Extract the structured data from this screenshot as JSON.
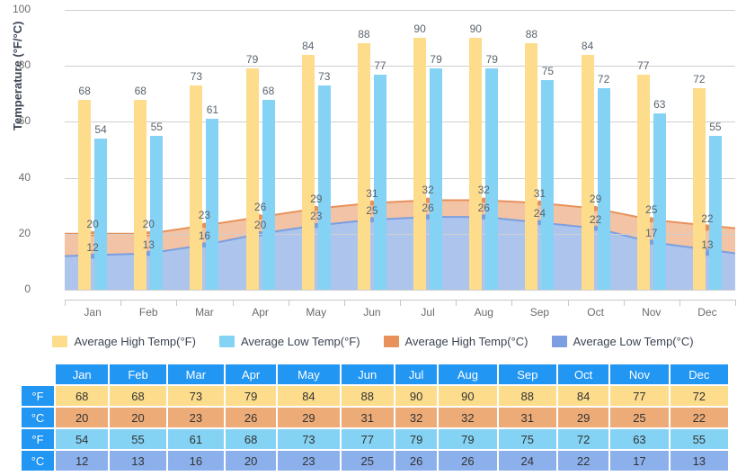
{
  "chart_data": {
    "type": "bar",
    "title": "",
    "xlabel": "",
    "ylabel": "Temperature (°F/°C)",
    "ylim": [
      0,
      100
    ],
    "yticks": [
      0,
      20,
      40,
      60,
      80,
      100
    ],
    "grid": true,
    "legend_position": "bottom",
    "categories": [
      "Jan",
      "Feb",
      "Mar",
      "Apr",
      "May",
      "Jun",
      "Jul",
      "Aug",
      "Sep",
      "Oct",
      "Nov",
      "Dec"
    ],
    "series": [
      {
        "name": "Average High Temp(°F)",
        "type": "bar",
        "color": "#fddc8c",
        "values": [
          68,
          68,
          73,
          79,
          84,
          88,
          90,
          90,
          88,
          84,
          77,
          72
        ]
      },
      {
        "name": "Average Low Temp(°F)",
        "type": "bar",
        "color": "#84d3f5",
        "values": [
          54,
          55,
          61,
          68,
          73,
          77,
          79,
          79,
          75,
          72,
          63,
          55
        ]
      },
      {
        "name": "Average High Temp(°C)",
        "type": "area",
        "color": "#e8915a",
        "values": [
          20,
          20,
          23,
          26,
          29,
          31,
          32,
          32,
          31,
          29,
          25,
          22
        ]
      },
      {
        "name": "Average Low Temp(°C)",
        "type": "area",
        "color": "#7b9fe0",
        "values": [
          12,
          13,
          16,
          20,
          23,
          25,
          26,
          26,
          24,
          22,
          17,
          13
        ]
      }
    ]
  },
  "legend": {
    "items": [
      {
        "label": "Average High Temp(°F)",
        "color": "#fddc8c"
      },
      {
        "label": "Average Low Temp(°F)",
        "color": "#84d3f5"
      },
      {
        "label": "Average High Temp(°C)",
        "color": "#e8915a"
      },
      {
        "label": "Average Low Temp(°C)",
        "color": "#7b9fe0"
      }
    ]
  },
  "table": {
    "corner": "",
    "columns": [
      "Jan",
      "Feb",
      "Mar",
      "Apr",
      "May",
      "Jun",
      "Jul",
      "Aug",
      "Sep",
      "Oct",
      "Nov",
      "Dec"
    ],
    "rows": [
      {
        "head": "°F",
        "style": "v-fh",
        "values": [
          "68",
          "68",
          "73",
          "79",
          "84",
          "88",
          "90",
          "90",
          "88",
          "84",
          "77",
          "72"
        ]
      },
      {
        "head": "°C",
        "style": "v-ch",
        "values": [
          "20",
          "20",
          "23",
          "26",
          "29",
          "31",
          "32",
          "32",
          "31",
          "29",
          "25",
          "22"
        ]
      },
      {
        "head": "°F",
        "style": "v-fl",
        "values": [
          "54",
          "55",
          "61",
          "68",
          "73",
          "77",
          "79",
          "79",
          "75",
          "72",
          "63",
          "55"
        ]
      },
      {
        "head": "°C",
        "style": "v-cl",
        "values": [
          "12",
          "13",
          "16",
          "20",
          "23",
          "25",
          "26",
          "26",
          "24",
          "22",
          "17",
          "13"
        ]
      }
    ]
  },
  "colors": {
    "f_high": "#fddc8c",
    "f_low": "#84d3f5",
    "c_high": "#e8915a",
    "c_low": "#7b9fe0",
    "table_header": "#2196f3",
    "gridline": "#cfcfcf"
  }
}
